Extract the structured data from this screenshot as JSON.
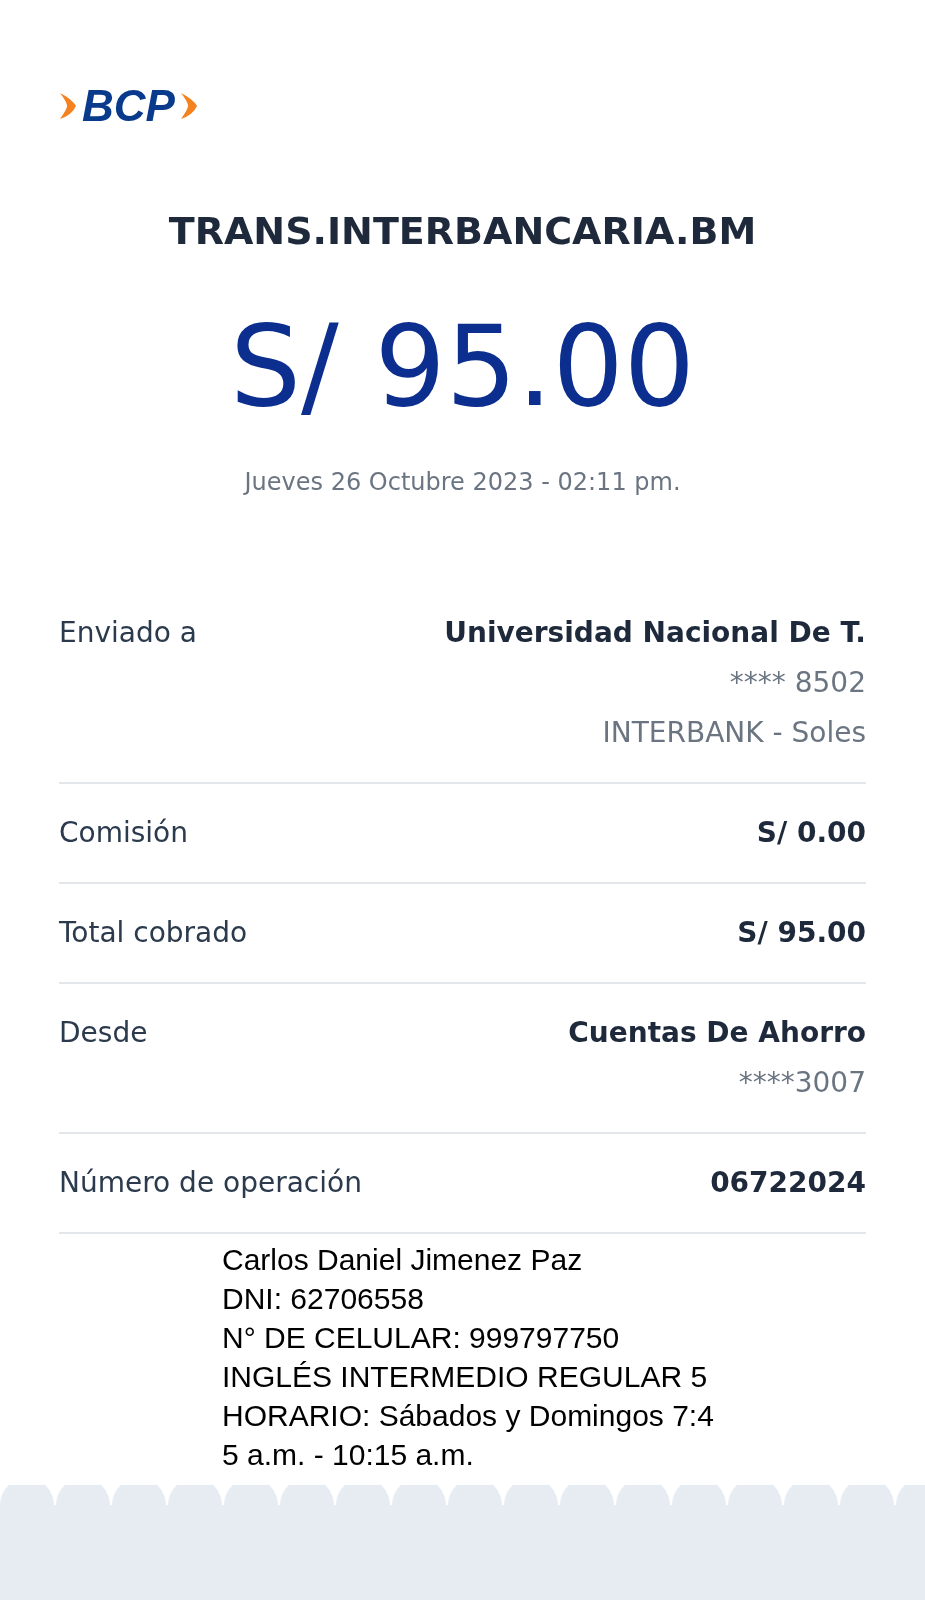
{
  "logo": {
    "text": "BCP"
  },
  "title": "TRANS.INTERBANCARIA.BM",
  "amount": "S/ 95.00",
  "date": "Jueves 26 Octubre 2023 - 02:11 pm.",
  "rows": [
    {
      "label": "Enviado a",
      "value": "Universidad Nacional De T.",
      "details": [
        "**** 8502",
        "INTERBANK - Soles"
      ]
    },
    {
      "label": "Comisión",
      "value": "S/ 0.00",
      "details": []
    },
    {
      "label": "Total cobrado",
      "value": "S/ 95.00",
      "details": []
    },
    {
      "label": "Desde",
      "value": "Cuentas De Ahorro",
      "details": [
        "****3007"
      ]
    },
    {
      "label": "Número de operación",
      "value": "06722024",
      "details": []
    }
  ],
  "note_lines": [
    "Carlos Daniel Jimenez Paz",
    "DNI: 62706558",
    "N° DE CELULAR: 999797750",
    "INGLÉS INTERMEDIO REGULAR 5",
    "HORARIO: Sábados y Domingos 7:4",
    "5 a.m. - 10:15 a.m."
  ]
}
